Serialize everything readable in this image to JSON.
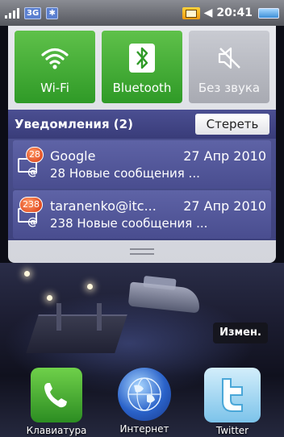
{
  "status_bar": {
    "network_type": "3G",
    "time": "20:41",
    "icons": [
      "signal-icon",
      "3g-icon",
      "bluetooth-status-icon",
      "notification-icon",
      "speaker-icon",
      "battery-icon"
    ]
  },
  "toggles": [
    {
      "label": "Wi-Fi",
      "state": "on",
      "icon": "wifi-icon"
    },
    {
      "label": "Bluetooth",
      "state": "on",
      "icon": "bluetooth-icon"
    },
    {
      "label": "Без звука",
      "state": "off",
      "icon": "mute-icon"
    }
  ],
  "notifications": {
    "title": "Уведомления (2)",
    "clear_label": "Стереть",
    "items": [
      {
        "sender": "Google",
        "date": "27 Апр 2010",
        "summary": "28 Новые сообщения ...",
        "count": "28"
      },
      {
        "sender": "taranenko@itc...",
        "date": "27 Апр 2010",
        "summary": "238 Новые сообщения ...",
        "count": "238"
      }
    ]
  },
  "home": {
    "edit_label": "Измен.",
    "dock": [
      {
        "label": "Клавиатура",
        "icon": "phone-icon"
      },
      {
        "label": "Интернет",
        "icon": "globe-icon"
      },
      {
        "label": "Twitter",
        "icon": "twitter-icon"
      }
    ]
  },
  "colors": {
    "toggle_on": "#3fae32",
    "header_bg": "#3f4283",
    "badge": "#e0471a"
  }
}
